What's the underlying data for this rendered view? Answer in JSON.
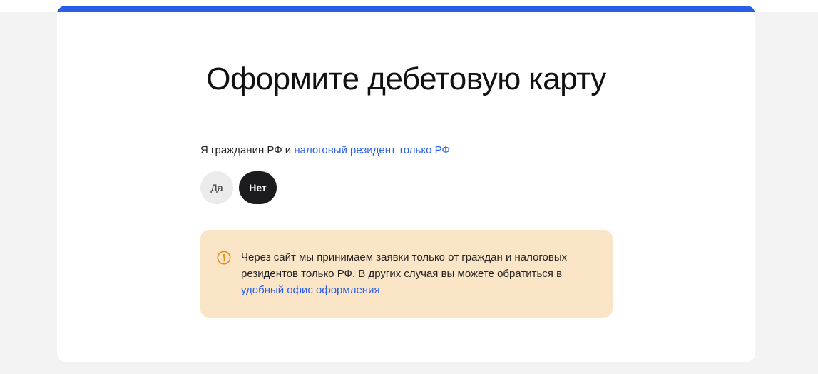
{
  "title": "Оформите дебетовую карту",
  "question": {
    "prefix": "Я гражданин РФ и",
    "link": "налоговый резидент только РФ"
  },
  "options": [
    {
      "label": "Да",
      "selected": false
    },
    {
      "label": "Нет",
      "selected": true
    }
  ],
  "notice": {
    "icon": "info-icon",
    "text": "Через сайт мы принимаем заявки только от граждан и налоговых резидентов только РФ. В других случая вы можете обратиться в",
    "link": "удобный офис оформления"
  },
  "colors": {
    "accent": "#2a5ee8",
    "notice_bg": "#fbe5c7",
    "icon": "#e8890c"
  }
}
